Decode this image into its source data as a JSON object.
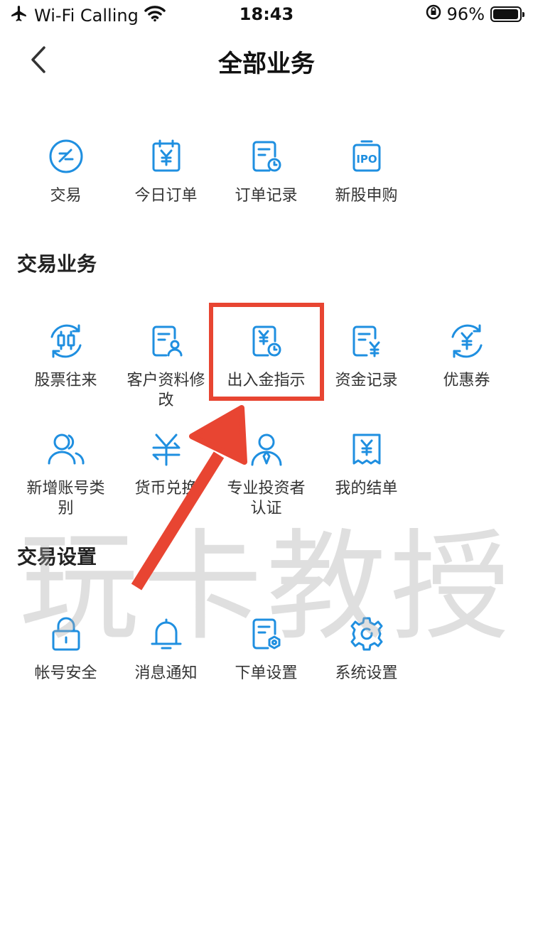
{
  "status_bar": {
    "carrier": "Wi-Fi Calling",
    "time": "18:43",
    "battery": "96%",
    "battery_level": 0.96
  },
  "nav": {
    "title": "全部业务"
  },
  "top_items": [
    {
      "label": "交易",
      "icon": "exchange-icon"
    },
    {
      "label": "今日订单",
      "icon": "calendar-yen-icon"
    },
    {
      "label": "订单记录",
      "icon": "document-clock-icon"
    },
    {
      "label": "新股申购",
      "icon": "ipo-icon"
    }
  ],
  "sections": [
    {
      "title": "交易业务",
      "items": [
        {
          "label": "股票往来",
          "icon": "stock-transfer-icon"
        },
        {
          "label": "客户资料修改",
          "icon": "profile-edit-icon"
        },
        {
          "label": "出入金指示",
          "icon": "deposit-withdraw-icon"
        },
        {
          "label": "资金记录",
          "icon": "fund-record-icon"
        },
        {
          "label": "优惠券",
          "icon": "coupon-icon"
        },
        {
          "label": "新增账号类别",
          "icon": "add-account-icon"
        },
        {
          "label": "货币兑换",
          "icon": "currency-exchange-icon"
        },
        {
          "label": "专业投资者认证",
          "icon": "investor-certify-icon"
        },
        {
          "label": "我的结单",
          "icon": "statement-icon"
        }
      ]
    },
    {
      "title": "交易设置",
      "items": [
        {
          "label": "帐号安全",
          "icon": "lock-icon"
        },
        {
          "label": "消息通知",
          "icon": "bell-icon"
        },
        {
          "label": "下单设置",
          "icon": "order-settings-icon"
        },
        {
          "label": "系统设置",
          "icon": "gear-icon"
        }
      ]
    }
  ],
  "watermark": "玩卡教授",
  "colors": {
    "accent": "#1f8fe0",
    "annotation": "#e84532"
  }
}
